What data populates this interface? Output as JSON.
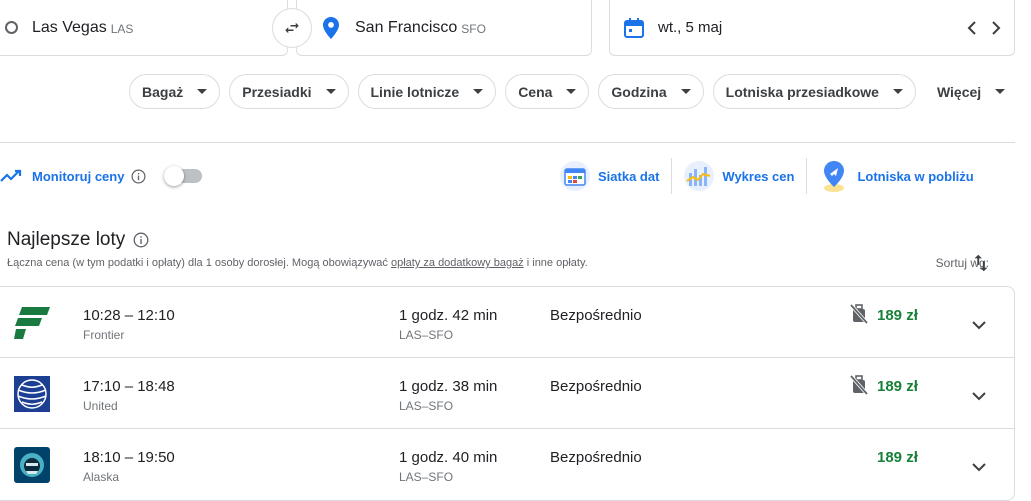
{
  "search": {
    "origin_city": "Las Vegas",
    "origin_code": "LAS",
    "destination_city": "San Francisco",
    "destination_code": "SFO",
    "date": "wt., 5 maj"
  },
  "filters": [
    "Bagaż",
    "Przesiadki",
    "Linie lotnicze",
    "Cena",
    "Godzina",
    "Lotniska przesiadkowe",
    "Więcej"
  ],
  "tracking": {
    "label": "Monitoruj ceny",
    "enabled": false
  },
  "tools": {
    "date_grid": "Siatka dat",
    "price_graph": "Wykres cen",
    "nearby_airports": "Lotniska w pobliżu"
  },
  "results": {
    "title": "Najlepsze loty",
    "note_prefix": "Łączna cena (w tym podatki i opłaty) dla 1 osoby dorosłej. Mogą obowiązywać",
    "note_link": "opłaty za dodatkowy bagaż",
    "note_suffix": "i inne opłaty.",
    "sort_label": "Sortuj wg:",
    "flights": [
      {
        "times": "10:28 – 12:10",
        "airline": "Frontier",
        "duration": "1 godz. 42 min",
        "route": "LAS–SFO",
        "stops": "Bezpośrednio",
        "price": "189 zł",
        "no_carry_on_icon": true
      },
      {
        "times": "17:10 – 18:48",
        "airline": "United",
        "duration": "1 godz. 38 min",
        "route": "LAS–SFO",
        "stops": "Bezpośrednio",
        "price": "189 zł",
        "no_carry_on_icon": true
      },
      {
        "times": "18:10 – 19:50",
        "airline": "Alaska",
        "duration": "1 godz. 40 min",
        "route": "LAS–SFO",
        "stops": "Bezpośrednio",
        "price": "189 zł",
        "no_carry_on_icon": false
      }
    ]
  },
  "colors": {
    "accent": "#1a73e8",
    "price_green": "#188038",
    "frontier": "#1a7a3f",
    "united": "#1c3f94",
    "alaska": "#01426a"
  }
}
